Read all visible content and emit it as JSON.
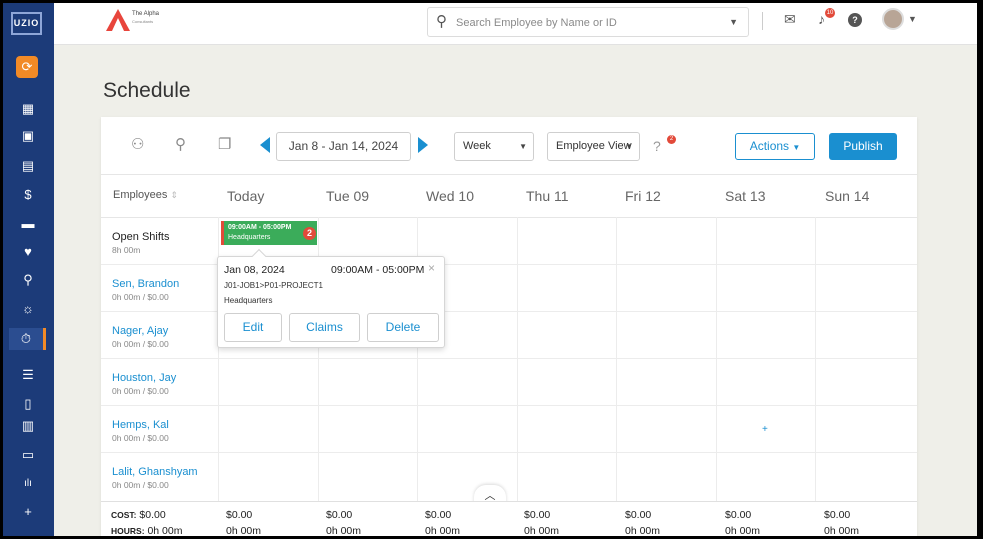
{
  "sidebar": {
    "logo": "UZIO",
    "items": [
      {
        "name": "sync-icon",
        "glyph": "⟳"
      },
      {
        "name": "dashboard-icon",
        "glyph": "▦"
      },
      {
        "name": "person-card-icon",
        "glyph": "▣"
      },
      {
        "name": "building-icon",
        "glyph": "▤"
      },
      {
        "name": "payroll-dollar-icon",
        "glyph": "$"
      },
      {
        "name": "wallet-icon",
        "glyph": "▬"
      },
      {
        "name": "heart-icon",
        "glyph": "♥"
      },
      {
        "name": "user-search-icon",
        "glyph": "⚲"
      },
      {
        "name": "beach-icon",
        "glyph": "☼"
      },
      {
        "name": "timer-icon",
        "glyph": "⏱"
      },
      {
        "name": "checklist-icon",
        "glyph": "☰"
      },
      {
        "name": "document-icon",
        "glyph": "▯"
      },
      {
        "name": "contacts-icon",
        "glyph": "▥"
      },
      {
        "name": "briefcase-icon",
        "glyph": "▭"
      },
      {
        "name": "reports-icon",
        "glyph": "ılı"
      },
      {
        "name": "add-folder-icon",
        "glyph": "+"
      }
    ]
  },
  "topbar": {
    "brand_name": "The Alpha",
    "brand_sub": "Consultants",
    "search_placeholder": "Search Employee by Name or ID",
    "bell_count": "10",
    "help": "?"
  },
  "page": {
    "title": "Schedule"
  },
  "toolbar": {
    "date_range": "Jan 8 - Jan 14, 2024",
    "period": "Week",
    "view": "Employee View",
    "message_count": "2",
    "actions_label": "Actions",
    "publish_label": "Publish"
  },
  "grid": {
    "employees_header": "Employees",
    "days": [
      "Today",
      "Tue 09",
      "Wed 10",
      "Thu 11",
      "Fri 12",
      "Sat 13",
      "Sun 14"
    ],
    "rows": [
      {
        "name": "Open Shifts",
        "sub": "8h 00m"
      },
      {
        "name": "Sen, Brandon",
        "sub": "0h 00m / $0.00"
      },
      {
        "name": "Nager, Ajay",
        "sub": "0h 00m / $0.00"
      },
      {
        "name": "Houston, Jay",
        "sub": "0h 00m / $0.00"
      },
      {
        "name": "Hemps, Kal",
        "sub": "0h 00m / $0.00"
      },
      {
        "name": "Lalit, Ghanshyam",
        "sub": "0h 00m / $0.00"
      }
    ],
    "add_cell": "+"
  },
  "shift": {
    "time": "09:00AM - 05:00PM",
    "location": "Headquarters",
    "count": "2"
  },
  "popover": {
    "date": "Jan 08, 2024",
    "time": "09:00AM - 05:00PM",
    "close": "×",
    "job": "J01-JOB1>P01-PROJECT1",
    "location": "Headquarters",
    "edit_label": "Edit",
    "claims_label": "Claims",
    "delete_label": "Delete"
  },
  "footer": {
    "cost_label": "COST:",
    "hours_label": "HOURS:",
    "total_cost": "$0.00",
    "total_hours": "0h 00m",
    "day_costs": [
      "$0.00",
      "$0.00",
      "$0.00",
      "$0.00",
      "$0.00",
      "$0.00",
      "$0.00"
    ],
    "day_hours": [
      "0h 00m",
      "0h 00m",
      "0h 00m",
      "0h 00m",
      "0h 00m",
      "0h 00m",
      "0h 00m"
    ]
  },
  "colors": {
    "sidebar": "#1c3b79",
    "accent_blue": "#1a8fd0",
    "shift_green": "#3bac5a",
    "badge_red": "#e24a3a",
    "active_orange": "#f28a26"
  }
}
